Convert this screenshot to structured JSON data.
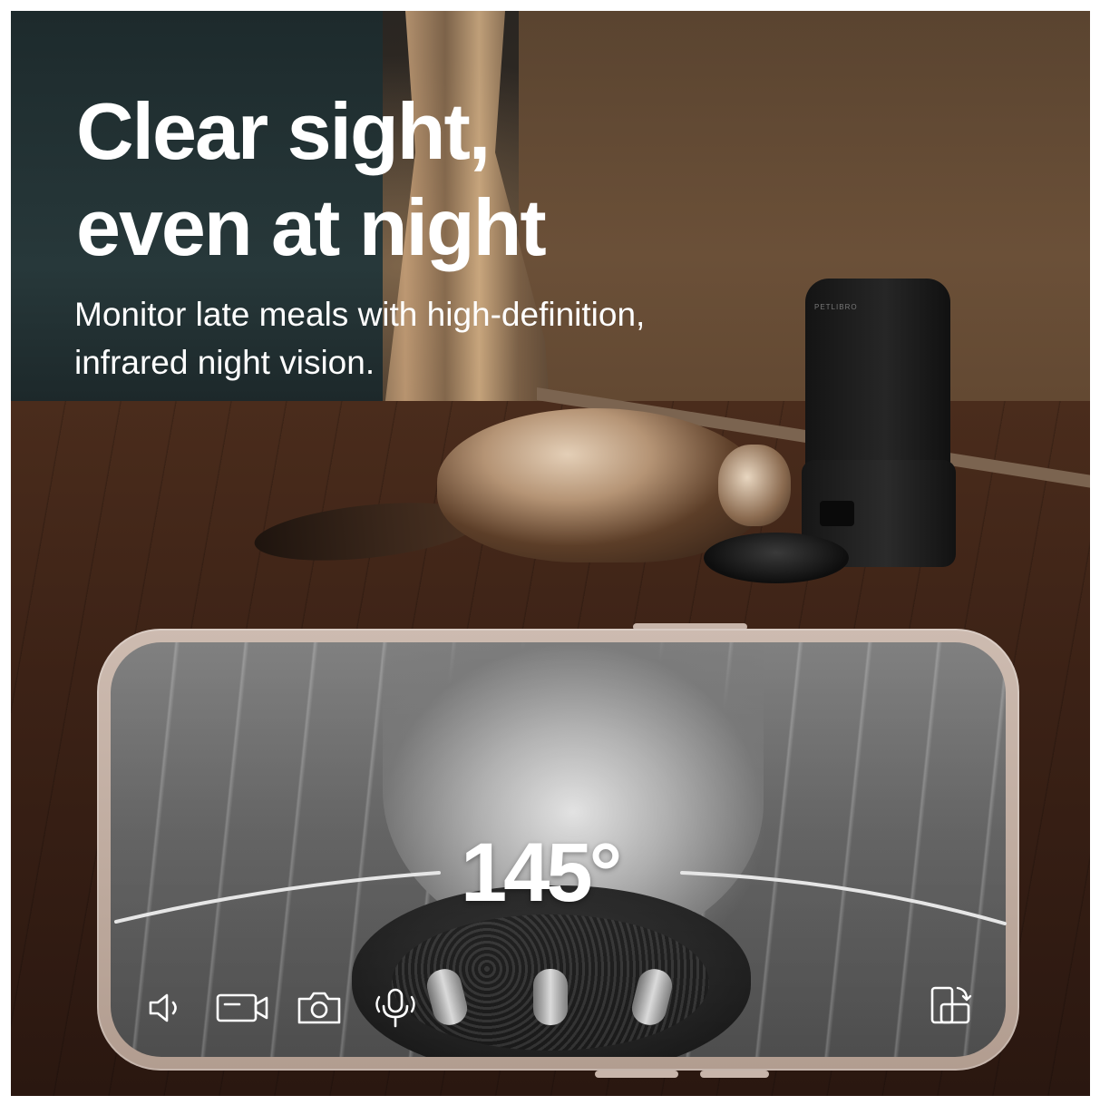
{
  "headline": "Clear sight,\neven at night",
  "subheadline": "Monitor late meals with high-definition, infrared night vision.",
  "feeder_brand": "PETLIBRO",
  "camera_view": {
    "field_of_view": "145°"
  },
  "controls": [
    {
      "name": "speaker-icon"
    },
    {
      "name": "record-video-icon"
    },
    {
      "name": "snapshot-camera-icon"
    },
    {
      "name": "microphone-icon"
    },
    {
      "name": "rotate-screen-icon"
    }
  ],
  "colors": {
    "headline_text": "#ffffff",
    "phone_frame": "#c0ab9f",
    "arc_line": "#e6e6e6"
  }
}
